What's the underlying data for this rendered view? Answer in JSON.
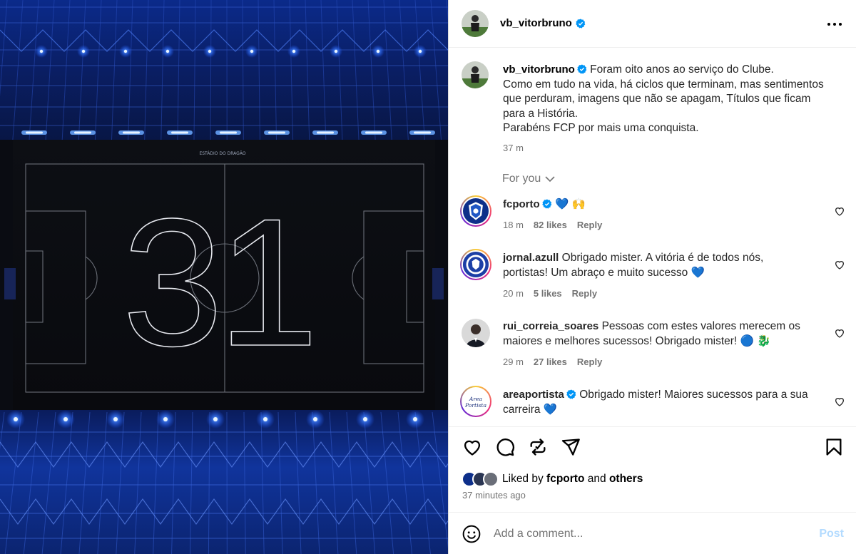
{
  "post": {
    "username": "vb_vitorbruno",
    "media": {
      "stadium_label": "ESTÁDIO DO DRAGÃO",
      "number": "31"
    },
    "caption_lines": [
      "Foram oito anos ao serviço do Clube.",
      "Como em tudo na vida, há ciclos que terminam, mas sentimentos",
      "que perduram, imagens que não se apagam, Títulos que ficam",
      "para a História.",
      "Parabéns FCP por mais uma conquista."
    ],
    "caption_time": "37 m"
  },
  "filter": {
    "label": "For you"
  },
  "comments": [
    {
      "username": "fcporto",
      "verified": true,
      "text_lines": [
        "💙 🙌"
      ],
      "time": "18 m",
      "likes": "82 likes",
      "reply": "Reply"
    },
    {
      "username": "jornal.azull",
      "verified": false,
      "text_lines": [
        "Obrigado mister. A vitória é de todos nós,",
        "portistas! Um abraço e muito sucesso 💙"
      ],
      "time": "20 m",
      "likes": "5 likes",
      "reply": "Reply"
    },
    {
      "username": "rui_correia_soares",
      "verified": false,
      "text_lines": [
        "Pessoas com estes valores merecem os",
        "maiores e melhores sucessos! Obrigado mister! 🔵 🐉"
      ],
      "time": "29 m",
      "likes": "27 likes",
      "reply": "Reply"
    },
    {
      "username": "areaportista",
      "verified": true,
      "text_lines": [
        "Obrigado mister! Maiores sucessos para a sua",
        "carreira 💙"
      ],
      "avatar_text": "Area Portista"
    }
  ],
  "likes_summary": {
    "prefix": "Liked by",
    "user": "fcporto",
    "middle": "and",
    "others": "others"
  },
  "post_time": "37 minutes ago",
  "add_comment": {
    "placeholder": "Add a comment...",
    "post_label": "Post"
  },
  "colors": {
    "verified": "#0095f6",
    "post_disabled": "#b3dbff",
    "muted": "#737373",
    "stadium_light": "#1e5bff"
  },
  "icons": [
    "more-icon",
    "verified-icon",
    "chevron-down-icon",
    "heart-icon",
    "comment-icon",
    "repost-icon",
    "share-icon",
    "bookmark-icon",
    "emoji-icon"
  ]
}
